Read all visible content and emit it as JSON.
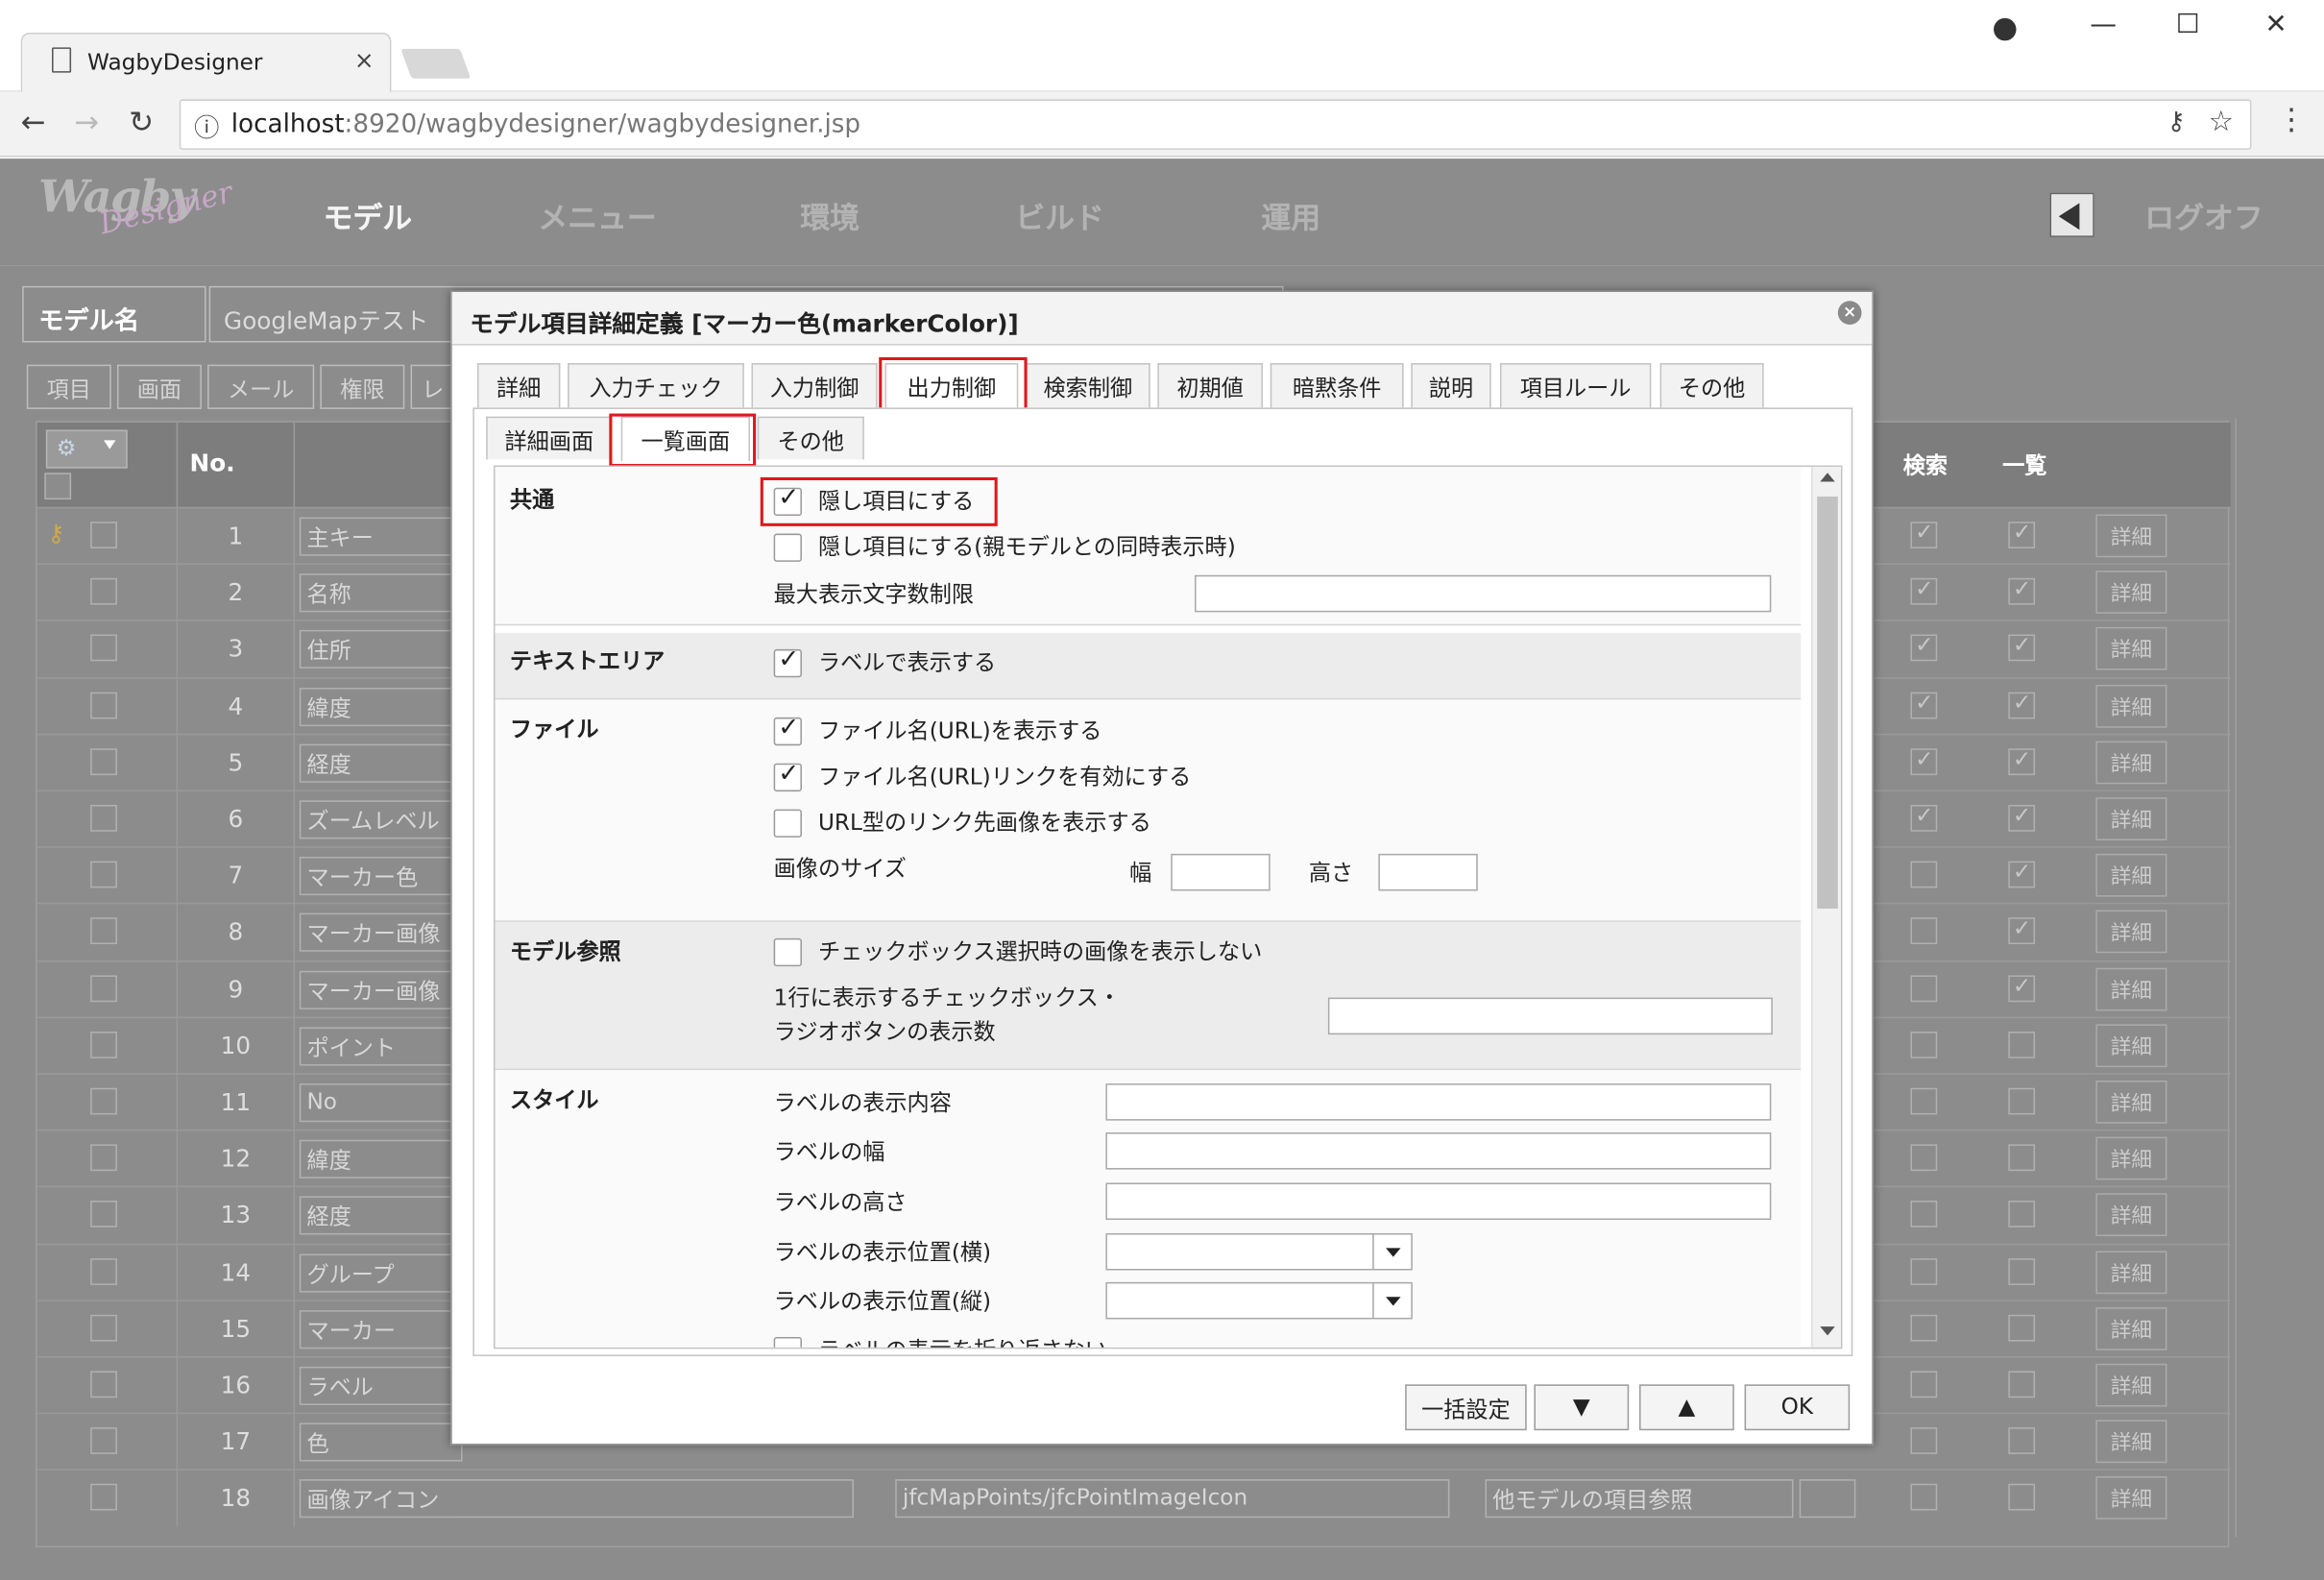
{
  "browser": {
    "tab_title": "WagbyDesigner",
    "url_host": "localhost",
    "url_rest": ":8920/wagbydesigner/wagbydesigner.jsp"
  },
  "app": {
    "logo_main": "Wagby",
    "logo_sub": "Designer",
    "menu": [
      "モデル",
      "メニュー",
      "環境",
      "ビルド",
      "運用"
    ],
    "logout": "ログオフ"
  },
  "page": {
    "model_label": "モデル名",
    "model_value": "GoogleMapテスト",
    "tabs": [
      "項目",
      "画面",
      "メール",
      "権限",
      "レ"
    ],
    "grid_header": {
      "no": "No.",
      "search": "検索",
      "list": "一覧"
    },
    "detail_label": "詳細",
    "rows": [
      {
        "no": "1",
        "name": "主キー",
        "search": true,
        "list": true
      },
      {
        "no": "2",
        "name": "名称",
        "search": true,
        "list": true
      },
      {
        "no": "3",
        "name": "住所",
        "search": true,
        "list": true
      },
      {
        "no": "4",
        "name": "緯度",
        "search": true,
        "list": true
      },
      {
        "no": "5",
        "name": "経度",
        "search": true,
        "list": true
      },
      {
        "no": "6",
        "name": "ズームレベル",
        "search": true,
        "list": true
      },
      {
        "no": "7",
        "name": "マーカー色",
        "search": false,
        "list": true
      },
      {
        "no": "8",
        "name": "マーカー画像",
        "search": false,
        "list": true
      },
      {
        "no": "9",
        "name": "マーカー画像",
        "search": false,
        "list": true
      },
      {
        "no": "10",
        "name": "ポイント",
        "search": false,
        "list": false
      },
      {
        "no": "11",
        "name": "No",
        "search": false,
        "list": false
      },
      {
        "no": "12",
        "name": "緯度",
        "search": false,
        "list": false
      },
      {
        "no": "13",
        "name": "経度",
        "search": false,
        "list": false
      },
      {
        "no": "14",
        "name": "グループ",
        "search": false,
        "list": false
      },
      {
        "no": "15",
        "name": "マーカー",
        "search": false,
        "list": false
      },
      {
        "no": "16",
        "name": "ラベル",
        "search": false,
        "list": false
      },
      {
        "no": "17",
        "name": "色",
        "search": false,
        "list": false
      },
      {
        "no": "18",
        "name": "画像アイコン",
        "search": false,
        "list": false
      }
    ],
    "row18_path": "jfcMapPoints/jfcPointImageIcon",
    "row18_type": "他モデルの項目参照"
  },
  "modal": {
    "title": "モデル項目詳細定義 [マーカー色(markerColor)]",
    "outer_tabs": [
      "詳細",
      "入力チェック",
      "入力制御",
      "出力制御",
      "検索制御",
      "初期値",
      "暗黙条件",
      "説明",
      "項目ルール",
      "その他"
    ],
    "inner_tabs": [
      "詳細画面",
      "一覧画面",
      "その他"
    ],
    "sections": {
      "common": {
        "heading": "共通",
        "hide": "隠し項目にする",
        "hide_parent": "隠し項目にする(親モデルとの同時表示時)",
        "max_chars": "最大表示文字数制限"
      },
      "textarea": {
        "heading": "テキストエリア",
        "label_display": "ラベルで表示する"
      },
      "file": {
        "heading": "ファイル",
        "show_name": "ファイル名(URL)を表示する",
        "enable_link": "ファイル名(URL)リンクを有効にする",
        "url_image": "URL型のリンク先画像を表示する",
        "image_size": "画像のサイズ",
        "width": "幅",
        "height": "高さ"
      },
      "model_ref": {
        "heading": "モデル参照",
        "no_image": "チェックボックス選択時の画像を表示しない",
        "per_line_1": "1行に表示するチェックボックス・",
        "per_line_2": "ラジオボタンの表示数"
      },
      "style": {
        "heading": "スタイル",
        "label_content": "ラベルの表示内容",
        "label_width": "ラベルの幅",
        "label_height": "ラベルの高さ",
        "label_pos_h": "ラベルの表示位置(横)",
        "label_pos_v": "ラベルの表示位置(縦)",
        "label_wrap": "ラベルの表示を折り返さない"
      }
    },
    "footer": {
      "bulk": "一括設定",
      "down": "▼",
      "up": "▲",
      "ok": "OK"
    }
  }
}
